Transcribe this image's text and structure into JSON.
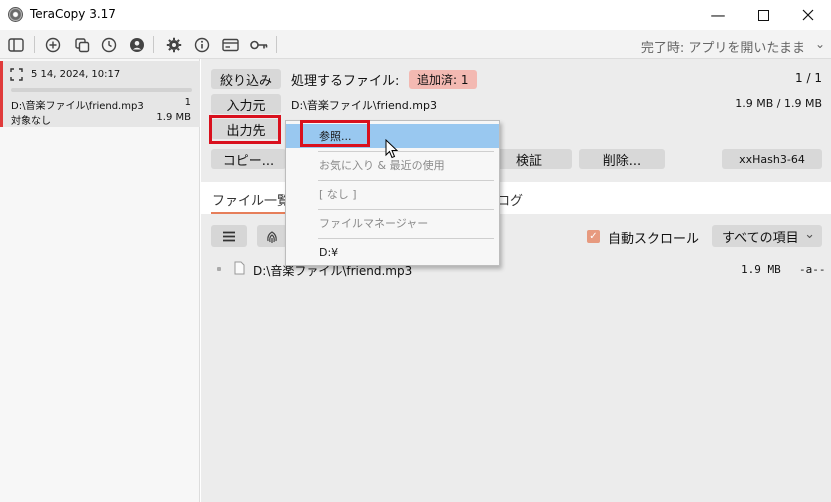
{
  "window": {
    "title": "TeraCopy 3.17",
    "minimize": "—",
    "maximize": "☐",
    "close": "✕"
  },
  "toolbar": {
    "icons": [
      "sidebar-toggle-icon",
      "add-icon",
      "copy-icon",
      "history-icon",
      "account-icon",
      "settings-icon",
      "info-icon",
      "panel-icon",
      "key-icon"
    ],
    "on_complete": "完了時: アプリを開いたまま",
    "chevron": "⌄"
  },
  "job": {
    "date": "5 14, 2024, 10:17",
    "path": "D:\\音楽ファイル\\friend.mp3",
    "count": "1",
    "status": "対象なし",
    "size": "1.9 MB"
  },
  "panel": {
    "filter_label": "絞り込み",
    "files_label": "処理するファイル:",
    "added_badge": "追加済: 1",
    "file_counter": "1 / 1",
    "source_label": "入力元",
    "source_path": "D:\\音楽ファイル\\friend.mp3",
    "source_size": "1.9 MB / 1.9 MB",
    "target_label": "出力先",
    "copy_button": "コピー...",
    "verify_button": "検証",
    "delete_button": "削除...",
    "hash_button": "xxHash3-64"
  },
  "tabs": {
    "file_list": "ファイル一覧",
    "log": "ログ"
  },
  "list_controls": {
    "auto_scroll": "自動スクロール",
    "filter_select": "すべての項目",
    "select_chevron": "⌄"
  },
  "file_row": {
    "path": "D:\\音楽ファイル\\friend.mp3",
    "size": "1.9 MB",
    "attr": "-a--"
  },
  "menu": {
    "browse": "参照...",
    "favorites": "お気に入り & 最近の使用",
    "none": "[ なし ]",
    "file_manager": "ファイルマネージャー",
    "drive": "D:¥"
  }
}
